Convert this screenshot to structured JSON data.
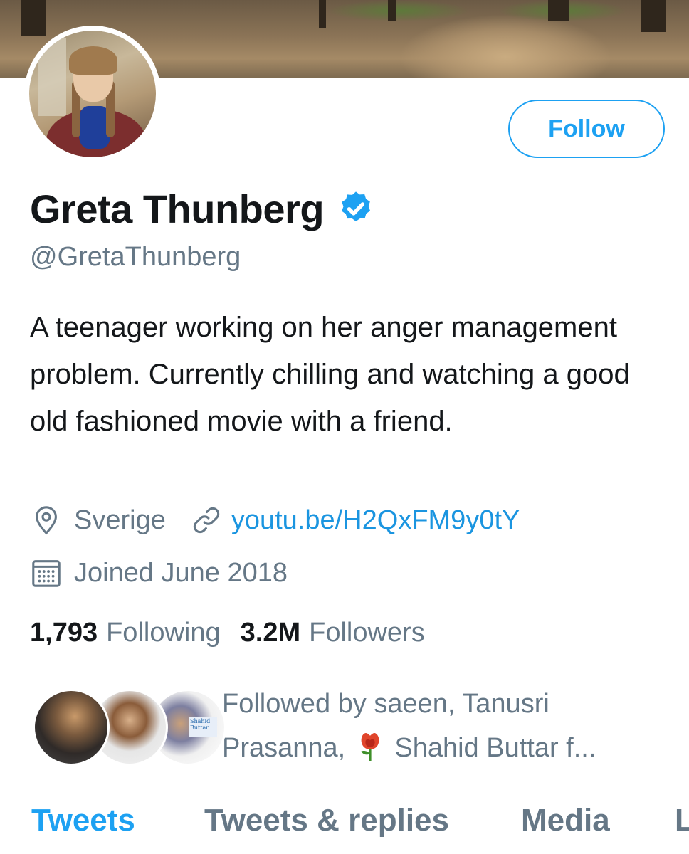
{
  "profile": {
    "name": "Greta Thunberg",
    "handle": "@GretaThunberg",
    "verified": true,
    "bio": "A teenager working on her anger management problem. Currently chilling and watching a good old fashioned movie with a friend.",
    "location": "Sverige",
    "link": "youtu.be/H2QxFM9y0tY",
    "joined": "Joined June 2018"
  },
  "actions": {
    "follow_label": "Follow"
  },
  "stats": {
    "following_count": "1,793",
    "following_label": "Following",
    "followers_count": "3.2M",
    "followers_label": "Followers"
  },
  "followed_by": {
    "prefix": "Followed by saeen, Tanusri Prasanna,",
    "suffix": "Shahid Buttar f...",
    "emoji": "rose-emoji",
    "avatar_tag": "Shahid Buttar"
  },
  "tabs": [
    {
      "label": "Tweets",
      "active": true
    },
    {
      "label": "Tweets & replies",
      "active": false
    },
    {
      "label": "Media",
      "active": false
    },
    {
      "label": "L",
      "active": false
    }
  ],
  "icons": {
    "verified": "verified-badge-icon",
    "location": "location-pin-icon",
    "link": "link-icon",
    "calendar": "calendar-icon"
  },
  "colors": {
    "accent": "#1da1f2",
    "link": "#1b95e0",
    "secondary_text": "#657786",
    "primary_text": "#14171a"
  }
}
